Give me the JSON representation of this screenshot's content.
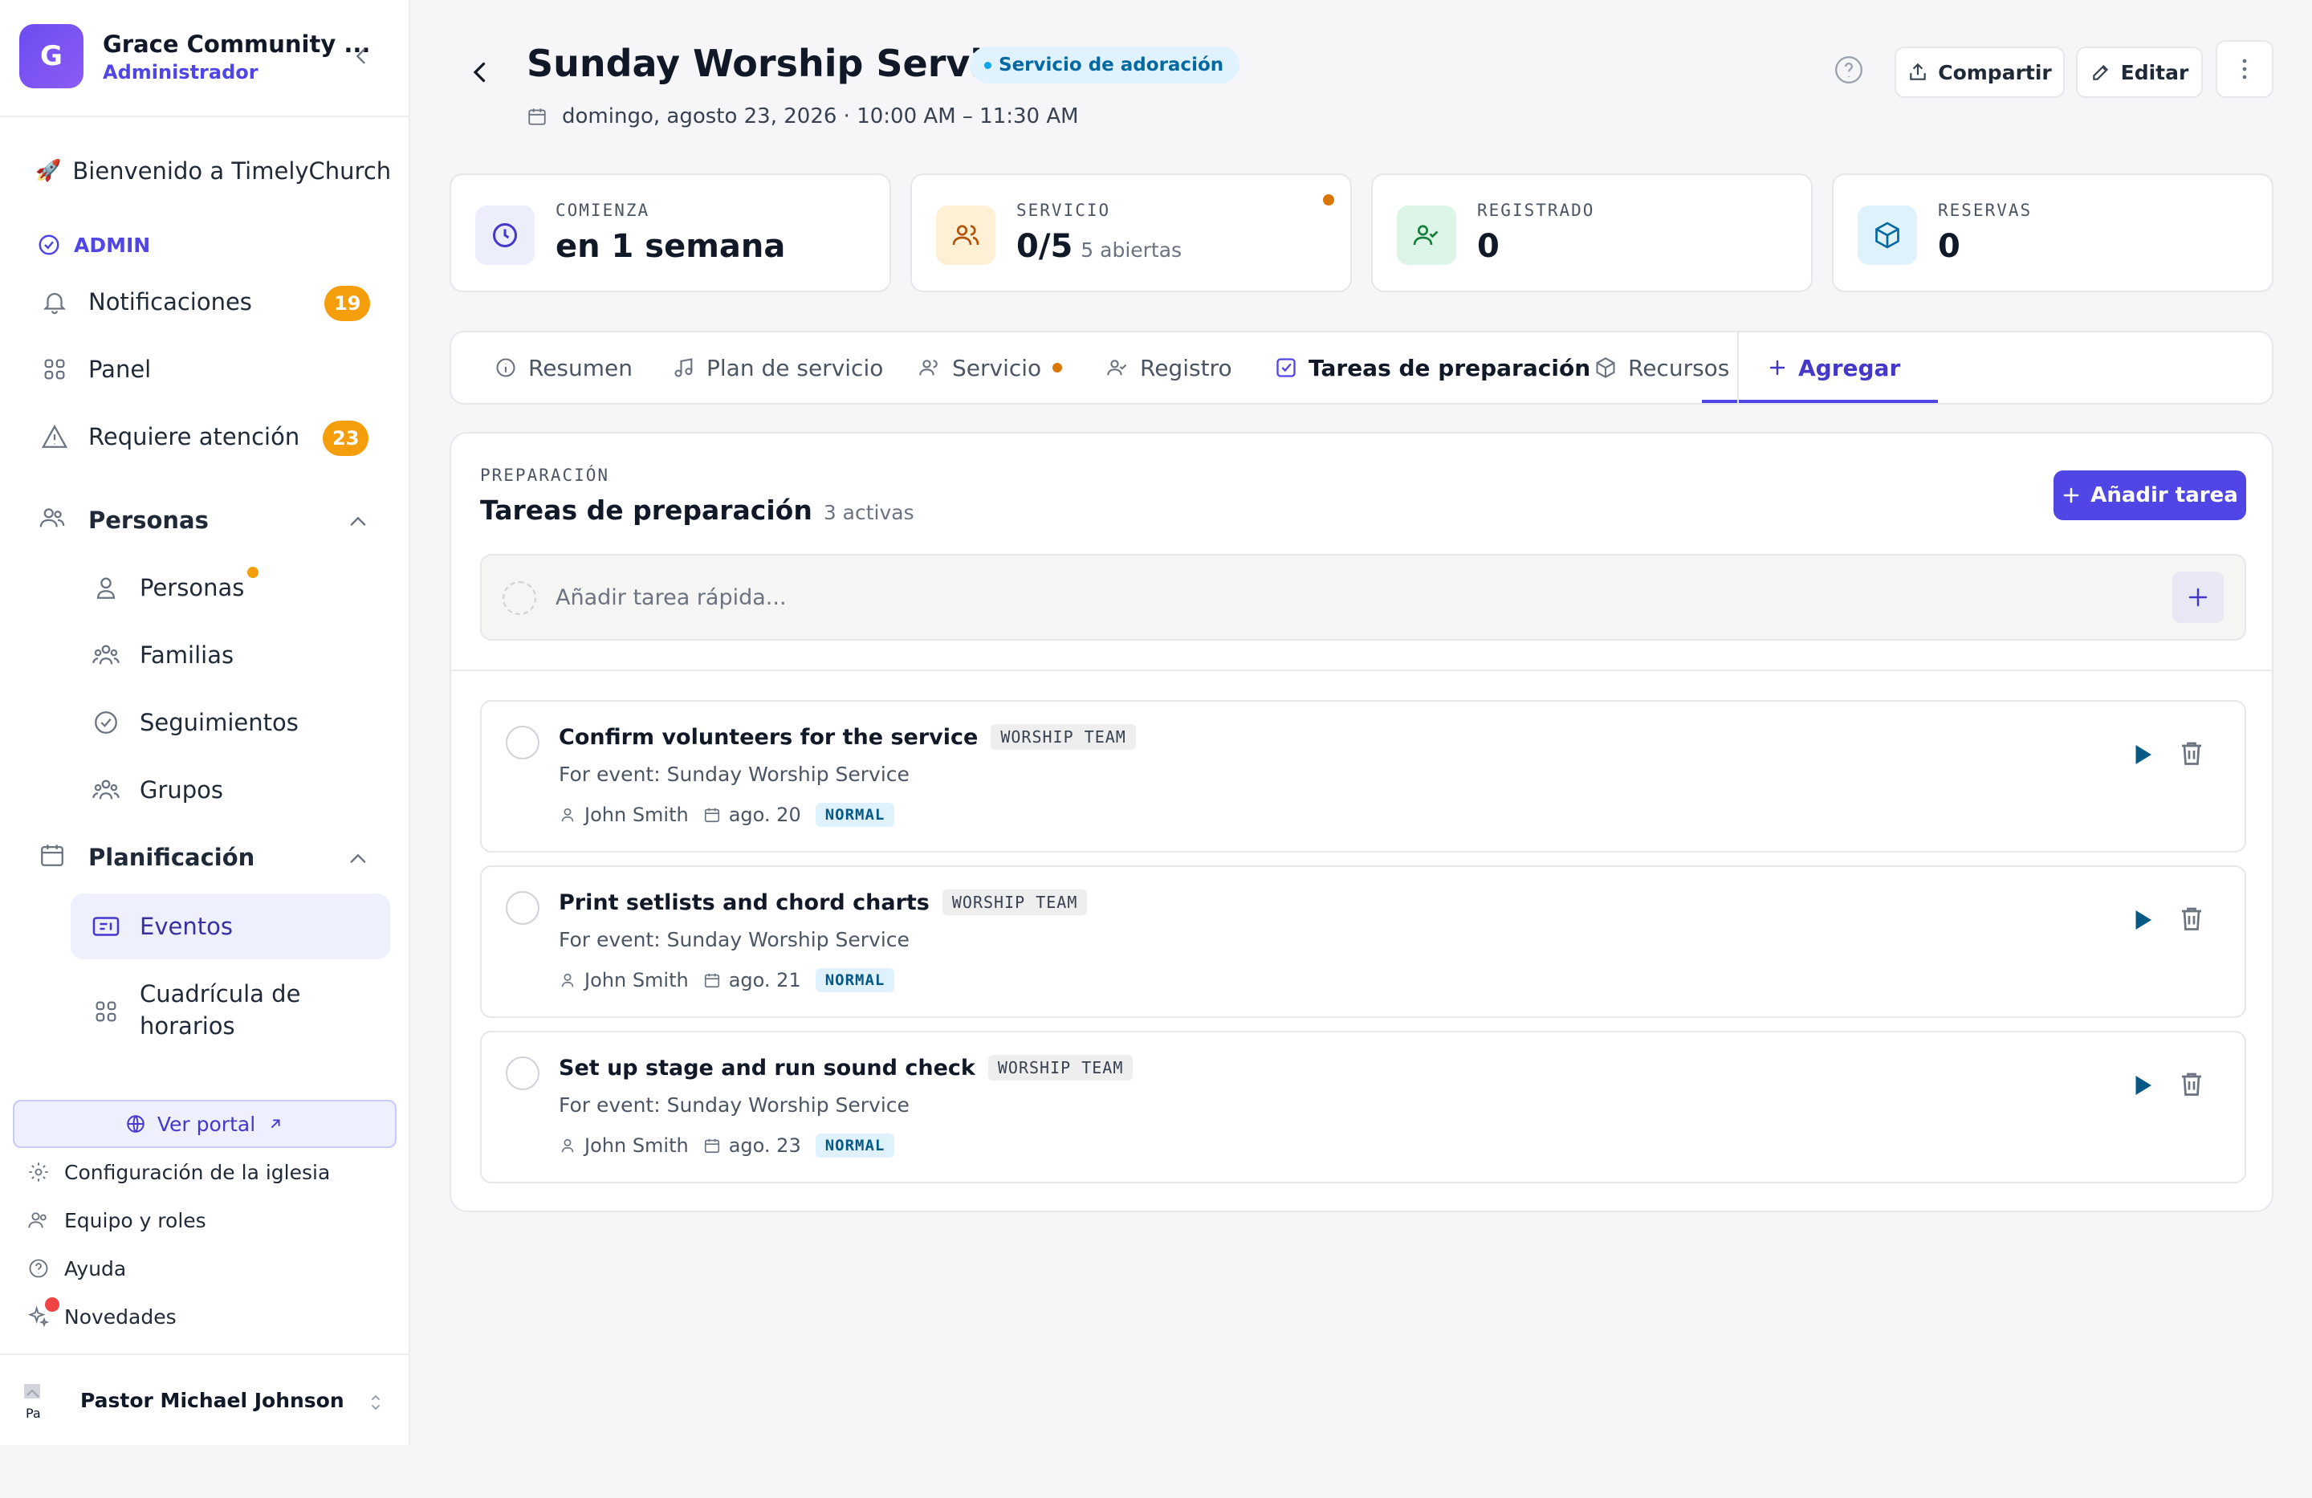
{
  "org": {
    "initial": "G",
    "name": "Grace Community ...",
    "role": "Administrador"
  },
  "sidebar": {
    "welcome": "Bienvenido a TimelyChurch",
    "admin_label": "ADMIN",
    "items": [
      {
        "label": "Notificaciones",
        "badge": "19"
      },
      {
        "label": "Panel"
      },
      {
        "label": "Requiere atención",
        "badge": "23"
      }
    ],
    "personas_section": "Personas",
    "personas_items": [
      "Personas",
      "Familias",
      "Seguimientos",
      "Grupos"
    ],
    "planificacion_section": "Planificación",
    "planificacion_items": [
      "Eventos",
      "Cuadrícula de",
      "horarios"
    ],
    "portal_label": "Ver portal",
    "footer_items": [
      "Configuración de la iglesia",
      "Equipo y roles",
      "Ayuda",
      "Novedades"
    ],
    "user_name": "Pastor Michael Johnson"
  },
  "header": {
    "title": "Sunday Worship Service",
    "type_pill": "Servicio de adoración",
    "date": "domingo, agosto 23, 2026 · 10:00 AM – 11:30 AM",
    "share_label": "Compartir",
    "edit_label": "Editar"
  },
  "stats": [
    {
      "label": "COMIENZA",
      "value": "en 1 semana",
      "sub": ""
    },
    {
      "label": "SERVICIO",
      "value": "0/5",
      "sub": "5 abiertas"
    },
    {
      "label": "REGISTRADO",
      "value": "0",
      "sub": ""
    },
    {
      "label": "RESERVAS",
      "value": "0",
      "sub": ""
    }
  ],
  "tabs": [
    "Resumen",
    "Plan de servicio",
    "Servicio",
    "Registro",
    "Tareas de preparación",
    "Recursos"
  ],
  "tabs_add": "Agregar",
  "panel": {
    "kicker": "PREPARACIÓN",
    "title": "Tareas de preparación",
    "count": "3 activas",
    "add_task": "Añadir tarea",
    "quick_placeholder": "Añadir tarea rápida..."
  },
  "tasks": [
    {
      "title": "Confirm volunteers for the service",
      "team": "WORSHIP TEAM",
      "subtitle": "For event: Sunday Worship Service",
      "assignee": "John Smith",
      "due": "ago. 20",
      "priority": "NORMAL"
    },
    {
      "title": "Print setlists and chord charts",
      "team": "WORSHIP TEAM",
      "subtitle": "For event: Sunday Worship Service",
      "assignee": "John Smith",
      "due": "ago. 21",
      "priority": "NORMAL"
    },
    {
      "title": "Set up stage and run sound check",
      "team": "WORSHIP TEAM",
      "subtitle": "For event: Sunday Worship Service",
      "assignee": "John Smith",
      "due": "ago. 23",
      "priority": "NORMAL"
    }
  ],
  "colors": {
    "accent": "#4f46e5",
    "badge": "#f59e0b",
    "active_bg": "#eef0fe",
    "pill_bg": "#e0f2fe"
  }
}
